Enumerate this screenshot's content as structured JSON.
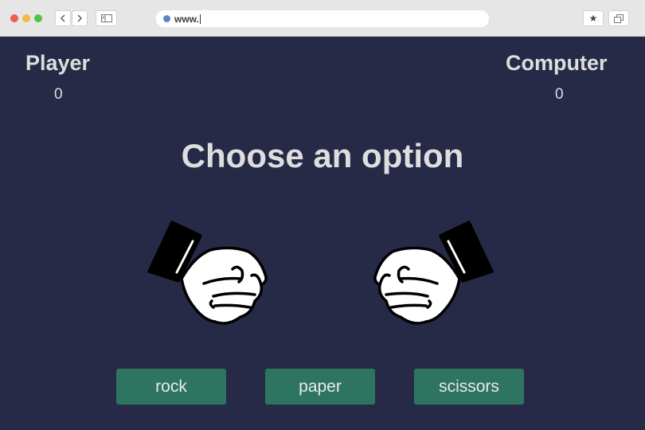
{
  "browser": {
    "url": "www."
  },
  "scoreboard": {
    "player_label": "Player",
    "player_score": "0",
    "computer_label": "Computer",
    "computer_score": "0"
  },
  "headline": "Choose an option",
  "choices": {
    "rock": "rock",
    "paper": "paper",
    "scissors": "scissors"
  },
  "icons": {
    "player_hand": "fist-icon",
    "computer_hand": "fist-icon"
  },
  "colors": {
    "background": "#272a47",
    "button": "#2e7561",
    "text": "#dedede"
  }
}
